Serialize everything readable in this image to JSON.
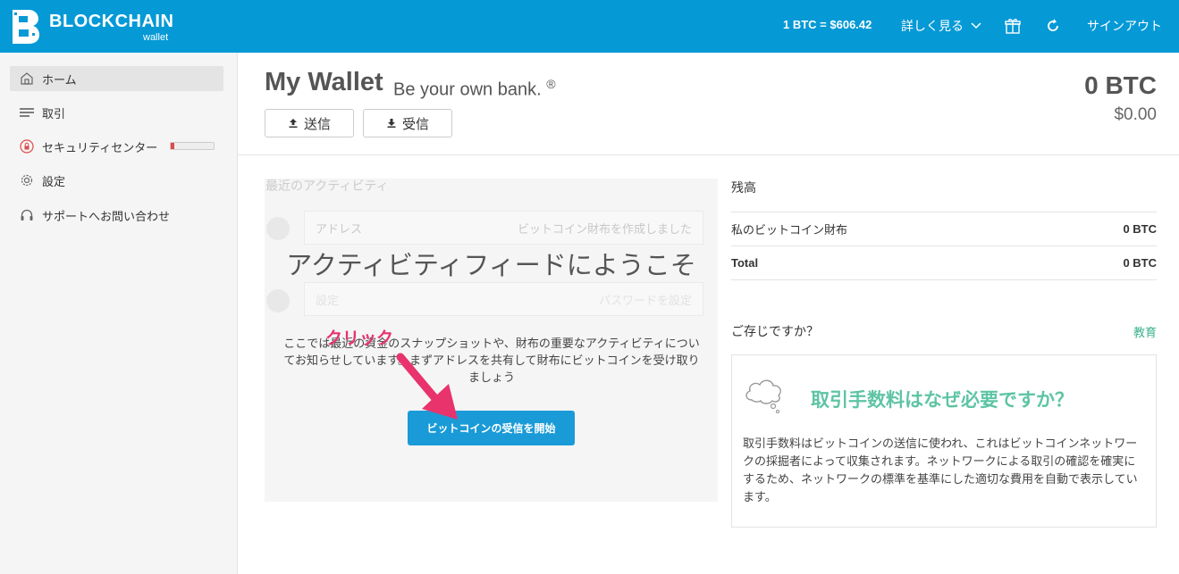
{
  "header": {
    "brand": "BLOCKCHAIN",
    "brand_sub": "wallet",
    "rate": "1 BTC =  $606.42",
    "more_label": "詳しく見る",
    "signout_label": "サインアウト"
  },
  "sidebar": {
    "items": [
      {
        "label": "ホーム",
        "icon": "home-icon"
      },
      {
        "label": "取引",
        "icon": "list-icon"
      },
      {
        "label": "セキュリティセンター",
        "icon": "lock-icon"
      },
      {
        "label": "設定",
        "icon": "gear-icon"
      },
      {
        "label": "サポートへお問い合わせ",
        "icon": "headset-icon"
      }
    ],
    "security_level": 0.08
  },
  "main": {
    "title": "My Wallet",
    "tagline": "Be your own bank.",
    "tagline_mark": "®",
    "send_label": "送信",
    "receive_label": "受信",
    "balance_btc": "0 BTC",
    "balance_usd": "$0.00"
  },
  "activity": {
    "title": "最近のアクティビティ",
    "ghost_rows": [
      {
        "left": "アドレス",
        "right": "ビットコイン財布を作成しました"
      },
      {
        "left": "設定",
        "right": "パスワードを設定"
      }
    ],
    "welcome": "アクティビティフィードにようこそ",
    "description": "ここでは最近の資金のスナップショットや、財布の重要なアクティビティについてお知らせしています。まずアドレスを共有して財布にビットコインを受け取りましょう",
    "cta_label": "ビットコインの受信を開始",
    "annotation": "クリック"
  },
  "balances": {
    "title": "残高",
    "rows": [
      {
        "label": "私のビットコイン財布",
        "value": "0 BTC"
      },
      {
        "label": "Total",
        "value": "0 BTC"
      }
    ]
  },
  "did_you_know": {
    "title": "ご存じですか？",
    "link": "教育",
    "card_title": "取引手数料はなぜ必要ですか？",
    "card_text": "取引手数料はビットコインの送信に使われ、これはビットコインネットワークの採掘者によって収集されます。ネットワークによる取引の確認を確実にするため、ネットワークの標準を基準にした適切な費用を自動で表示しています。"
  },
  "colors": {
    "header_bg": "#0599d6",
    "cta_bg": "#1a9bd7",
    "accent_green": "#5ec4a4",
    "annotation": "#e8336d"
  }
}
